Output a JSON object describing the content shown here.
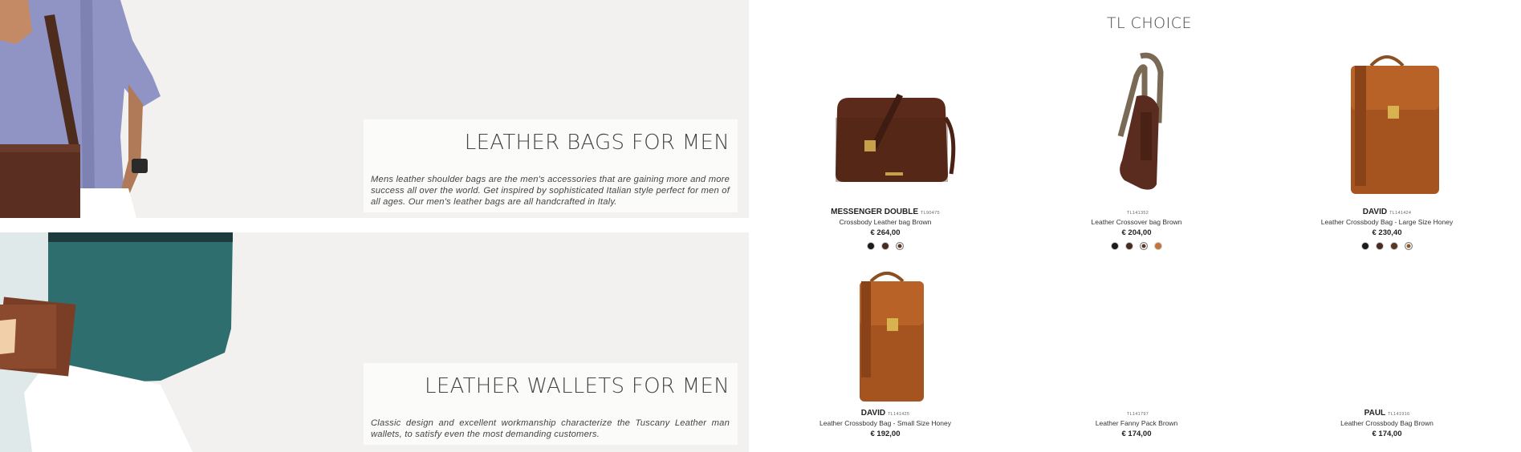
{
  "banners": [
    {
      "title": "LEATHER BAGS FOR MEN",
      "text": "Mens leather shoulder bags are the men's accessories that are gaining more and more success all over the world. Get inspired by sophisticated Italian style perfect for men of all ages. Our men's leather bags are all handcrafted in Italy."
    },
    {
      "title": "LEATHER WALLETS FOR MEN",
      "text": "Classic design and excellent workmanship characterize the Tuscany Leather man wallets, to satisfy even the most demanding customers."
    }
  ],
  "choice": {
    "title": "TL CHOICE",
    "products": [
      {
        "name": "MESSENGER DOUBLE",
        "code": "TL90475",
        "desc": "Crossbody Leather bag Brown",
        "price": "€ 264,00",
        "swatches": [
          "#1c1c1c",
          "#4a2b1f",
          "#5a3425"
        ],
        "selected": 2
      },
      {
        "name": "",
        "code": "TL141352",
        "desc": "Leather Crossover bag Brown",
        "price": "€ 204,00",
        "swatches": [
          "#1c1c1c",
          "#4a2b1f",
          "#5a3425",
          "#c0743a"
        ],
        "selected": 2
      },
      {
        "name": "DAVID",
        "code": "TL141424",
        "desc": "Leather Crossbody Bag - Large Size Honey",
        "price": "€ 230,40",
        "swatches": [
          "#1c1c1c",
          "#4a2b1f",
          "#5a3425",
          "#8a5a2b"
        ],
        "selected": 3
      },
      {
        "name": "DAVID",
        "code": "TL141425",
        "desc": "Leather Crossbody Bag - Small Size Honey",
        "price": "€ 192,00",
        "swatches": [],
        "selected": -1
      },
      {
        "name": "",
        "code": "TL141797",
        "desc": "Leather Fanny Pack Brown",
        "price": "€ 174,00",
        "swatches": [],
        "selected": -1
      },
      {
        "name": "PAUL",
        "code": "TL141916",
        "desc": "Leather Crossbody Bag Brown",
        "price": "€ 174,00",
        "swatches": [],
        "selected": -1
      }
    ]
  }
}
